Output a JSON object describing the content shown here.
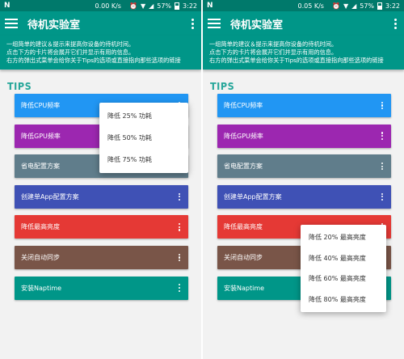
{
  "left": {
    "status": {
      "speed": "0.00 K/s",
      "battery": "57%",
      "time": "3:22"
    },
    "popup_items": [
      "降低 25% 功耗",
      "降低 50% 功耗",
      "降低 75% 功耗"
    ]
  },
  "right": {
    "status": {
      "speed": "0.05 K/s",
      "battery": "57%",
      "time": "3:22"
    },
    "popup_items": [
      "降低 20% 最高亮度",
      "降低 40% 最高亮度",
      "降低 60% 最高亮度",
      "降低 80% 最高亮度"
    ]
  },
  "app": {
    "title": "待机实验室",
    "desc_lines": [
      "一组简单的建议＆提示来提高你设备的待机时间。",
      "点击下方的卡片将会展开它们并显示有用的信息。",
      "右方的弹出式菜单会给你关于Tips的选项或直接指向那些选项的链接"
    ],
    "section_title": "TIPS"
  },
  "cards": [
    {
      "label": "降低CPU频率",
      "color": "#2196f3"
    },
    {
      "label": "降低GPU频率",
      "color": "#9c27b0"
    },
    {
      "label": "省电配置方案",
      "color": "#607d8b"
    },
    {
      "label": "创建单App配置方案",
      "color": "#3f51b5"
    },
    {
      "label": "降低最高亮度",
      "color": "#e53935"
    },
    {
      "label": "关闭自动同步",
      "color": "#795548"
    },
    {
      "label": "安装Naptime",
      "color": "#009688"
    }
  ]
}
